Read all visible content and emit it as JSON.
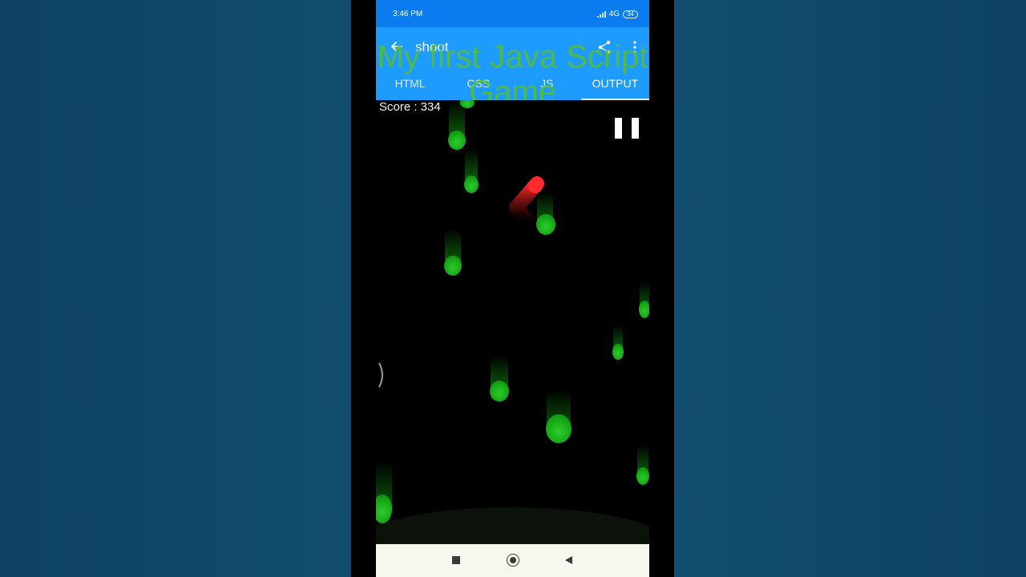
{
  "status_bar": {
    "time": "3:46 PM",
    "network": "4G",
    "battery": "34"
  },
  "app_bar": {
    "title": "shoot",
    "back_icon": "arrow-left-icon",
    "share_icon": "share-icon",
    "more_icon": "more-vertical-icon"
  },
  "tabs": [
    {
      "label": "HTML",
      "active": false
    },
    {
      "label": "CSS",
      "active": false
    },
    {
      "label": "JS",
      "active": false
    },
    {
      "label": "OUTPUT",
      "active": true
    }
  ],
  "overlay_title": "My first Java Script Game",
  "game": {
    "score_label": "Score : 334",
    "pause_icon": "pause-icon",
    "player_color": "#ff2a2a",
    "drop_color": "#1fbf1f"
  },
  "nav_bar": {
    "recent_icon": "square-recent-icon",
    "home_icon": "circle-home-icon",
    "back_icon": "triangle-back-icon"
  },
  "colors": {
    "status_bar": "#0a7cf0",
    "app_bar": "#1e9bff",
    "background": "#0f4a6b"
  }
}
